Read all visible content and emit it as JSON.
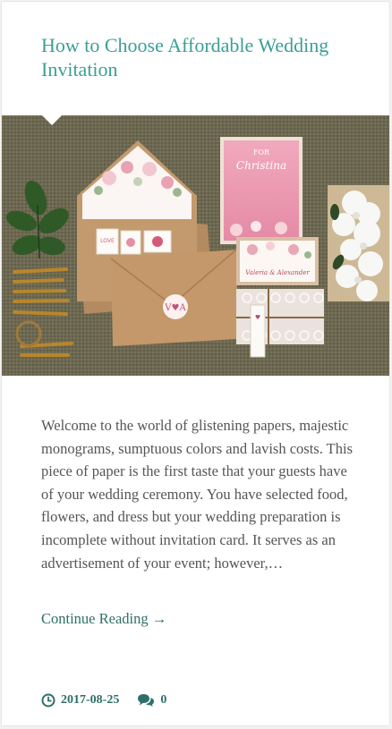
{
  "post": {
    "title": "How to Choose Affordable Wedding Invitation",
    "featured_image_alt": "wedding invitation set with envelopes, stamps, leaves and white flowers on burlap",
    "excerpt": "Welcome to the world of glistening papers, majestic monograms, sumptuous colors and lavish costs. This piece of paper is the first taste that your guests have of your wedding ceremony. You have selected food, flowers, and dress but your wedding preparation is incomplete without invitation card. It serves as an advertisement of your event; however,…",
    "read_more": "Continue Reading →",
    "date": "2017-08-25",
    "comments": "0"
  },
  "colors": {
    "title": "#3a9f96",
    "link": "#2e6f6a",
    "text": "#555555",
    "burlap": "#6d6851"
  },
  "icons": {
    "date": "clock-icon",
    "comments": "comments-icon"
  }
}
